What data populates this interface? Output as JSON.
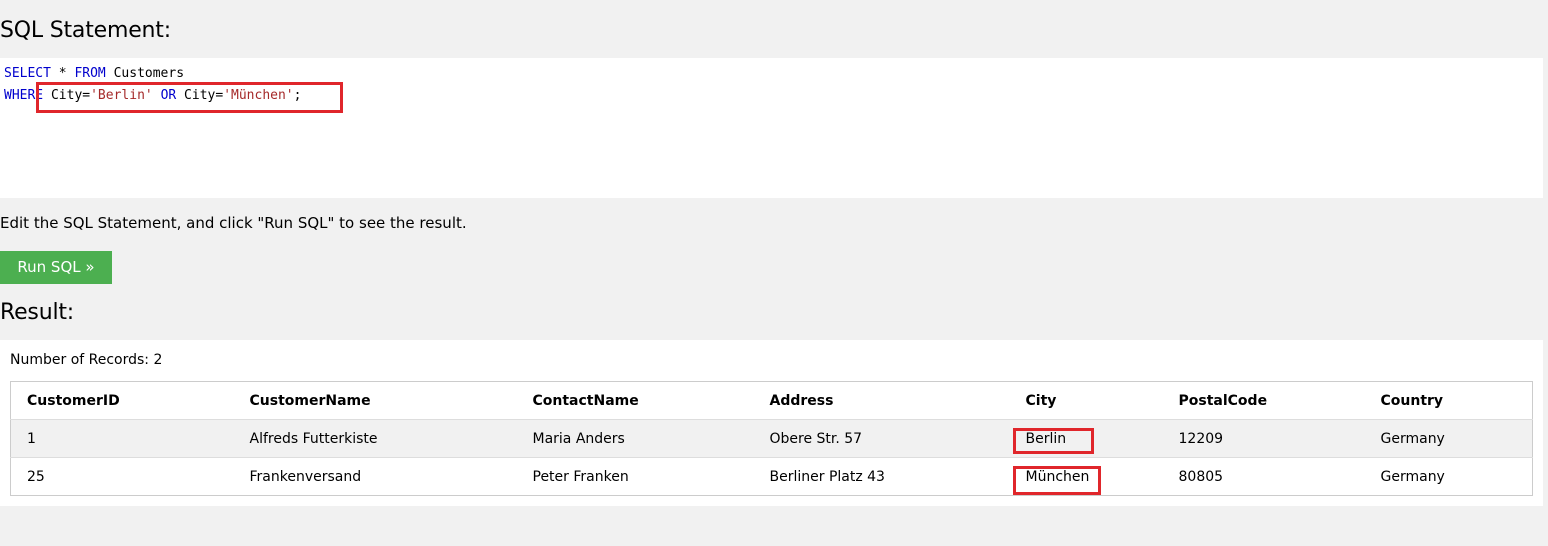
{
  "sql_section": {
    "heading": "SQL Statement:",
    "line1": {
      "kw1": "SELECT",
      "mid": " * ",
      "kw2": "FROM",
      "rest": " Customers"
    },
    "line2": {
      "kw1": "WHERE",
      "p1": " City=",
      "s1": "'Berlin'",
      "sp1": " ",
      "kw2": "OR",
      "p2": " City=",
      "s2": "'München'",
      "end": ";"
    }
  },
  "hint": "Edit the SQL Statement, and click \"Run SQL\" to see the result.",
  "run_button": "Run SQL »",
  "result": {
    "heading": "Result:",
    "records": "Number of Records: 2",
    "columns": [
      "CustomerID",
      "CustomerName",
      "ContactName",
      "Address",
      "City",
      "PostalCode",
      "Country"
    ],
    "rows": [
      [
        "1",
        "Alfreds Futterkiste",
        "Maria Anders",
        "Obere Str. 57",
        "Berlin",
        "12209",
        "Germany"
      ],
      [
        "25",
        "Frankenversand",
        "Peter Franken",
        "Berliner Platz 43",
        "München",
        "80805",
        "Germany"
      ]
    ]
  },
  "colors": {
    "highlight": "#e0262b",
    "button": "#4caf50",
    "keyword": "#0000cd",
    "string": "#a52a2a"
  }
}
